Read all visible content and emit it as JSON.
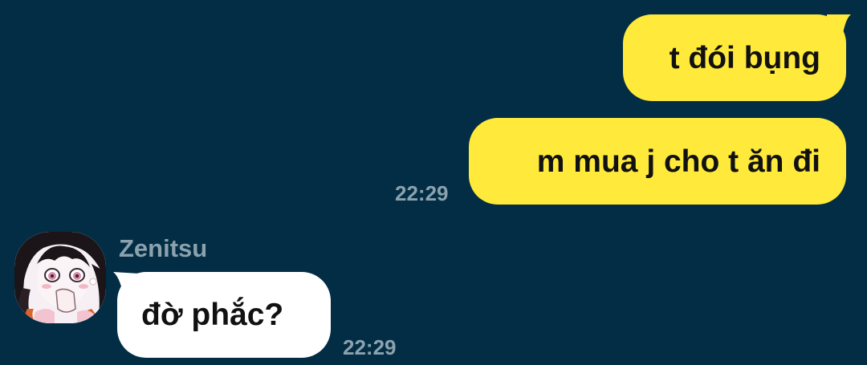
{
  "messages": [
    {
      "direction": "outgoing",
      "text": "t đói bụng"
    },
    {
      "direction": "outgoing",
      "text": "m mua j cho t ăn đi",
      "time": "22:29"
    },
    {
      "direction": "incoming",
      "sender": "Zenitsu",
      "text": "đờ phắc?",
      "time": "22:29",
      "avatar_icon": "anime-girl-avatar"
    }
  ],
  "colors": {
    "background": "#022d44",
    "outgoing_bubble": "#ffe93b",
    "incoming_bubble": "#ffffff",
    "meta_text": "#8ba2ae",
    "message_text": "#111111"
  }
}
